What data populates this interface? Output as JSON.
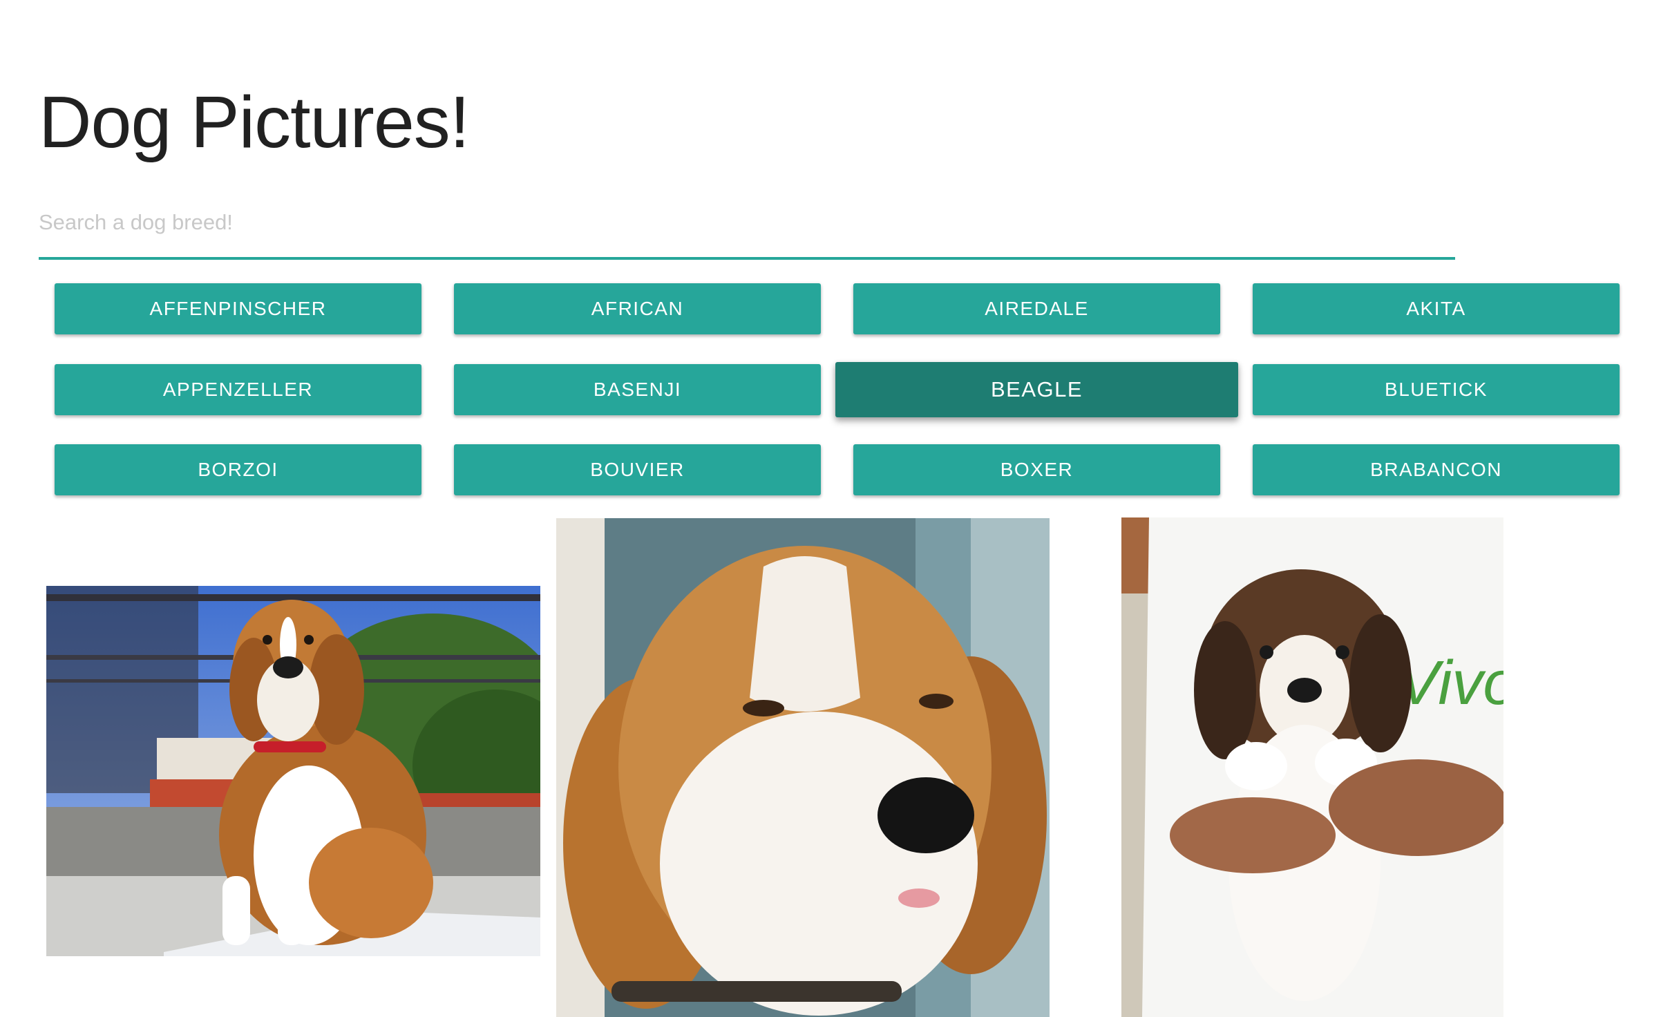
{
  "header": {
    "title": "Dog Pictures!"
  },
  "search": {
    "placeholder": "Search a dog breed!",
    "value": ""
  },
  "breeds": [
    "AFFENPINSCHER",
    "AFRICAN",
    "AIREDALE",
    "AKITA",
    "APPENZELLER",
    "BASENJI",
    "BEAGLE",
    "BLUETICK",
    "BORZOI",
    "BOUVIER",
    "BOXER",
    "BRABANCON"
  ],
  "selected_breed": "BEAGLE",
  "colors": {
    "accent": "#26a69a",
    "accent_active": "#1e7d72",
    "title": "#212121"
  },
  "gallery": {
    "photos": [
      {
        "name": "beagle-sitting-on-newspaper"
      },
      {
        "name": "beagle-face-closeup"
      },
      {
        "name": "beagle-puppy-held"
      }
    ]
  }
}
